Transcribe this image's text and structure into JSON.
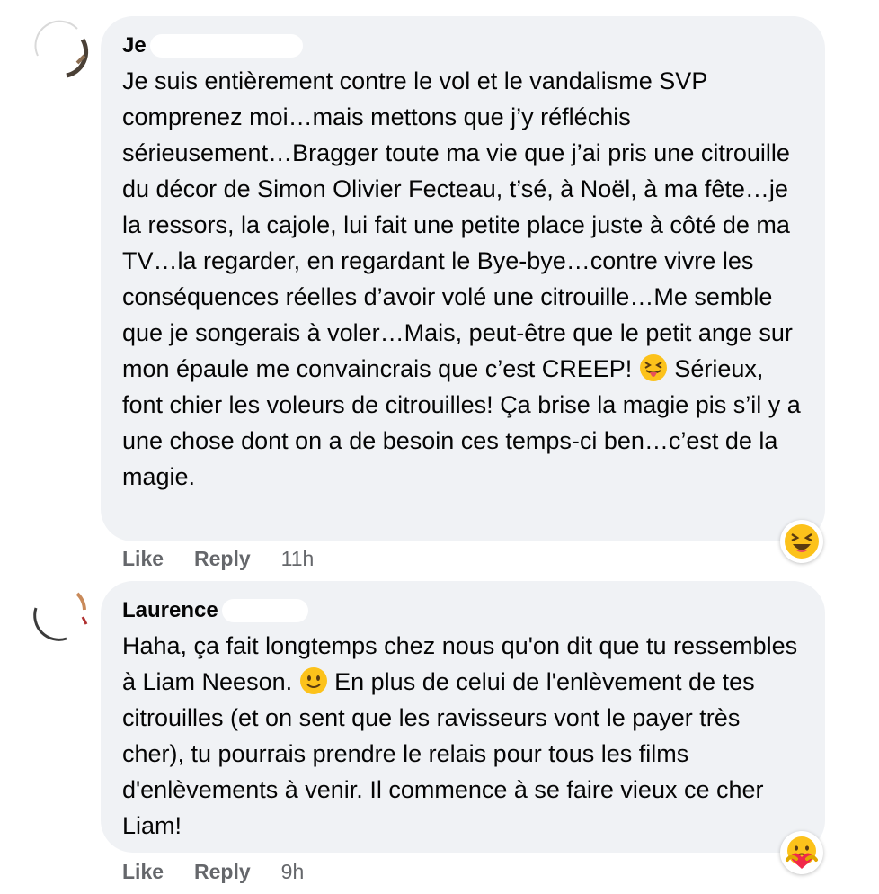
{
  "comments": [
    {
      "author": "Je",
      "text": "Je suis entièrement contre le vol et le vandalisme SVP comprenez moi…mais mettons que j’y réfléchis sérieusement…Bragger toute ma vie que j’ai pris une citrouille du décor de Simon Olivier Fecteau, t’sé, à Noël, à ma fête…je la ressors, la cajole, lui fait une petite place juste à côté de ma TV…la regarder, en regardant le Bye-bye…contre vivre les conséquences réelles d’avoir volé une citrouille…Me semble que je songerais à voler…Mais, peut-être que le petit ange sur mon épaule me convaincrais que c’est CREEP!",
      "text_after_emoji": "Sérieux, font chier les voleurs de citrouilles! Ça brise la magie pis s’il y a une chose dont on a de besoin ces temps-ci ben…c’est de la magie.",
      "inline_emoji": "squinting-tongue-emoji",
      "like_label": "Like",
      "reply_label": "Reply",
      "timestamp": "11h",
      "reaction": "laughing-reaction-icon"
    },
    {
      "author": "Laurence",
      "text_before_emoji": "Haha, ça fait longtemps chez nous qu'on dit que tu ressembles à Liam Neeson.",
      "inline_emoji": "slight-smile-emoji",
      "text": "En plus de celui de l'enlèvement de tes citrouilles (et on sent que les ravisseurs vont le payer très cher), tu pourrais prendre le relais pour tous les films d'enlèvements à venir. Il commence à se faire vieux ce cher Liam!",
      "like_label": "Like",
      "reply_label": "Reply",
      "timestamp": "9h",
      "reaction": "care-reaction-icon"
    }
  ],
  "colors": {
    "bubble": "#f0f2f5",
    "text": "#050505",
    "muted": "#65676b",
    "emoji_yellow": "#fcc21b",
    "care_red": "#f0284a"
  }
}
